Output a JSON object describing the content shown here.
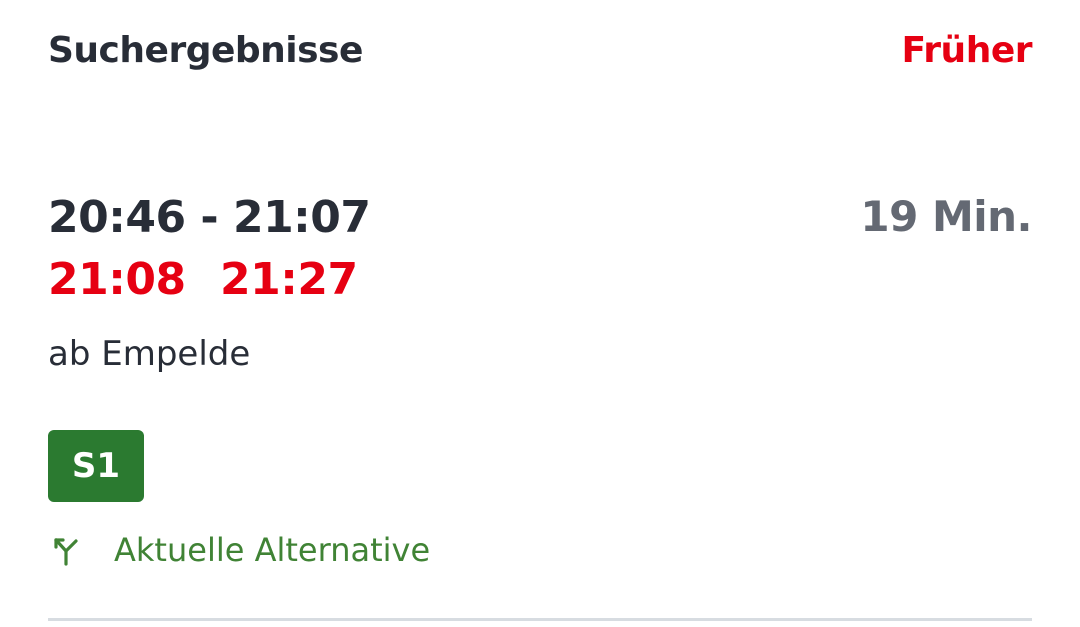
{
  "header": {
    "title": "Suchergebnisse",
    "earlier_label": "Früher"
  },
  "connection": {
    "planned_times": "20:46 - 21:07",
    "duration": "19 Min.",
    "realtime_departure": "21:08",
    "realtime_arrival": "21:27",
    "origin": "ab Empelde",
    "line": "S1",
    "alternative_label": "Aktuelle Alternative"
  },
  "colors": {
    "accent_red": "#e60012",
    "text_dark": "#282d37",
    "text_grey": "#646973",
    "line_badge_green": "#2b7a30",
    "alternative_green": "#408335"
  },
  "icons": {
    "alternative": "route-fork-icon"
  }
}
